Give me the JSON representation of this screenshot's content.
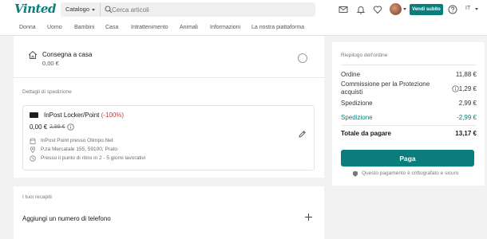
{
  "header": {
    "logo": "Vinted",
    "catalog_label": "Catalogo",
    "search_placeholder": "Cerca articoli",
    "sell_button": "Vendi subito",
    "language": "IT",
    "icons": [
      "mail-icon",
      "bell-icon",
      "heart-icon",
      "help-icon"
    ]
  },
  "categories": [
    "Donna",
    "Uomo",
    "Bambini",
    "Casa",
    "Intrattenimento",
    "Animali",
    "Informazioni",
    "La nostra piattaforma"
  ],
  "delivery": {
    "home_title": "Consegna a casa",
    "home_price": "0,00 €",
    "shipping_details_label": "Dettagli di spedizione",
    "pickup": {
      "name": "InPost Locker/Point",
      "discount": "(-100%)",
      "price": "0,00 €",
      "old_price": "2,99 €",
      "point": "InPost Point presso Olimpo.Net",
      "address": "P.za Mercatale 155, 59100, Prato",
      "timing": "Presso il punto di ritiro in 2 - 5 giorni lavorativi"
    }
  },
  "contacts": {
    "label": "I tuoi recapiti",
    "add_phone": "Aggiungi un numero di telefono"
  },
  "summary": {
    "title": "Riepilogo dell'ordine",
    "order_label": "Ordine",
    "order_value": "11,88 €",
    "protection_label_1": "Commissione per la Protezione",
    "protection_label_2": "acquisti",
    "protection_value": "1,29 €",
    "shipping_label": "Spedizione",
    "shipping_value": "2,99 €",
    "shipping_discount_label": "Spedizione",
    "shipping_discount_value": "-2,99 €",
    "total_label": "Totale da pagare",
    "total_value": "13,17 €",
    "pay_button": "Paga",
    "secure_note": "Questo pagamento è crittografato e sicuro"
  },
  "colors": {
    "brand": "#0b7d7d",
    "discount": "#c33a3a",
    "background": "#f2f2f2"
  }
}
